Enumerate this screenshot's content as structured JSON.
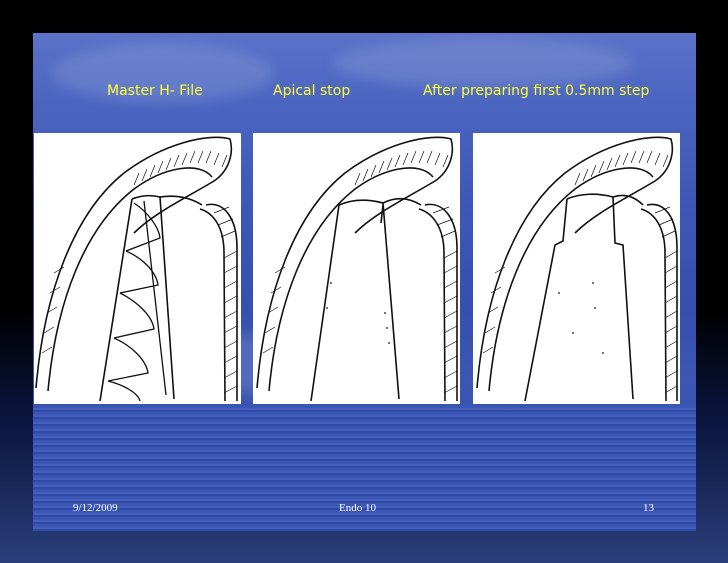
{
  "slide": {
    "captions": [
      "Master H- File",
      "Apical stop",
      "After preparing first 0.5mm step"
    ],
    "footer": {
      "date": "9/12/2009",
      "center": "Endo 10",
      "page_number": "13"
    }
  },
  "colors": {
    "background": "#000000",
    "slide_blue": "#3d57b6",
    "caption_yellow": "#ffff33",
    "footer_text": "#ffffff"
  }
}
